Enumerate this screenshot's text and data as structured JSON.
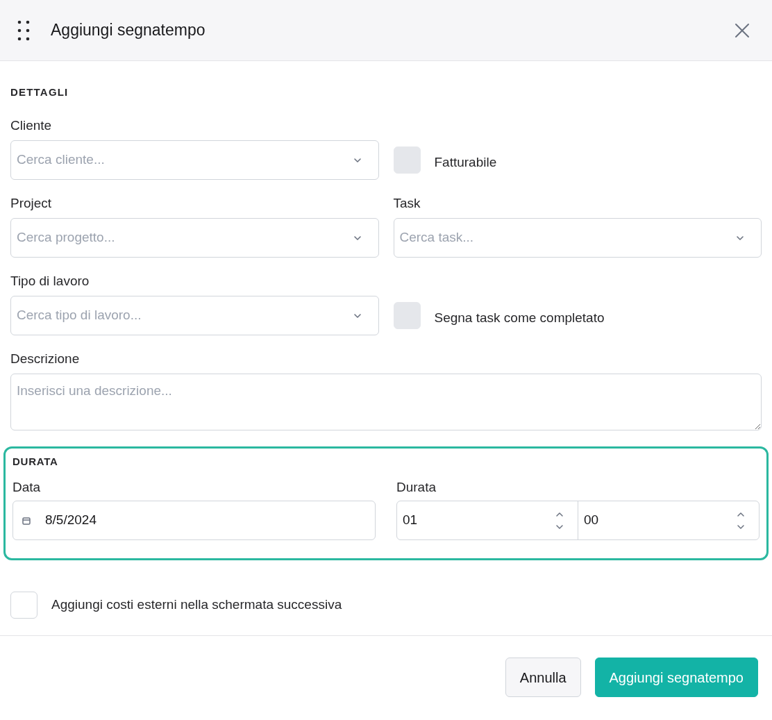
{
  "dialog": {
    "title": "Aggiungi segnatempo"
  },
  "details": {
    "heading": "DETTAGLI",
    "rows": [
      [
        {
          "kind": "select",
          "label": "Cliente",
          "placeholder": "Cerca cliente..."
        },
        {
          "kind": "checkbox",
          "label": "Fatturabile",
          "checked": false,
          "disabled": true
        }
      ],
      [
        {
          "kind": "select",
          "label": "Project",
          "placeholder": "Cerca progetto..."
        },
        {
          "kind": "select",
          "label": "Task",
          "placeholder": "Cerca task..."
        }
      ],
      [
        {
          "kind": "select",
          "label": "Tipo di lavoro",
          "placeholder": "Cerca tipo di lavoro..."
        },
        {
          "kind": "checkbox",
          "label": "Segna task come completato",
          "checked": false,
          "disabled": true
        }
      ]
    ],
    "description": {
      "label": "Descrizione",
      "placeholder": "Inserisci una descrizione..."
    }
  },
  "duration": {
    "heading": "DURATA",
    "highlighted": true,
    "date": {
      "label": "Data",
      "value": "8/5/2024"
    },
    "time": {
      "label": "Durata",
      "hours": "01",
      "minutes": "00"
    }
  },
  "external_costs": {
    "label": "Aggiungi costi esterni nella schermata successiva",
    "checked": false,
    "disabled": false
  },
  "buttons": [
    {
      "kind": "secondary",
      "label": "Annulla"
    },
    {
      "kind": "primary",
      "label": "Aggiungi segnatempo"
    }
  ]
}
